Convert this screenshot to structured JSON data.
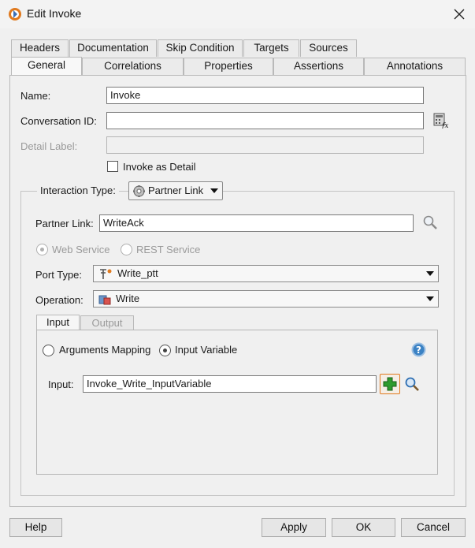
{
  "window": {
    "title": "Edit Invoke",
    "icon": "oracle-bpel-icon",
    "close_icon": "close-icon"
  },
  "tabs_row1": [
    "Headers",
    "Documentation",
    "Skip Condition",
    "Targets",
    "Sources"
  ],
  "tabs_row2": [
    "General",
    "Correlations",
    "Properties",
    "Assertions",
    "Annotations"
  ],
  "active_tab": "General",
  "general": {
    "name_label": "Name:",
    "name_value": "Invoke",
    "conversation_label": "Conversation ID:",
    "conversation_value": "",
    "detail_label_label": "Detail Label:",
    "detail_label_value": "",
    "invoke_as_detail_label": "Invoke as Detail",
    "invoke_as_detail_checked": false
  },
  "interaction": {
    "label": "Interaction Type:",
    "value": "Partner Link",
    "partner_link_label": "Partner Link:",
    "partner_link_value": "WriteAck",
    "web_service_label": "Web Service",
    "rest_service_label": "REST Service",
    "selected_service": "Web Service",
    "port_type_label": "Port Type:",
    "port_type_value": "Write_ptt",
    "operation_label": "Operation:",
    "operation_value": "Write"
  },
  "io_tabs": [
    "Input",
    "Output"
  ],
  "active_io_tab": "Input",
  "input": {
    "arguments_mapping_label": "Arguments Mapping",
    "input_variable_label": "Input Variable",
    "selected_mode": "Input Variable",
    "input_label": "Input:",
    "input_value": "Invoke_Write_InputVariable"
  },
  "buttons": {
    "help": "Help",
    "apply": "Apply",
    "ok": "OK",
    "cancel": "Cancel"
  },
  "colors": {
    "accent_orange": "#e07a1f",
    "plus_green": "#2e9b2e",
    "help_blue": "#3b82c4"
  }
}
